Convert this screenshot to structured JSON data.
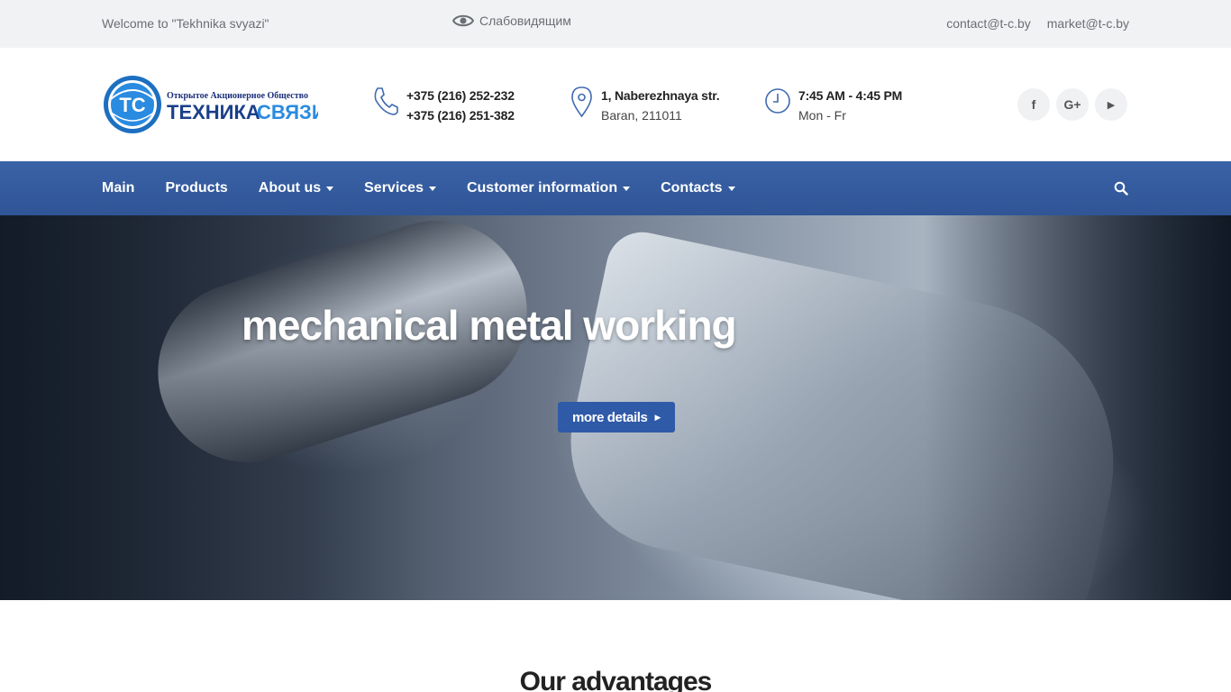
{
  "topbar": {
    "welcome": "Welcome to \"Tekhnika svyazi\"",
    "low_vision": "Слабовидящим",
    "emails": [
      "contact@t-c.by",
      "market@t-c.by"
    ]
  },
  "logo": {
    "mark": "TC",
    "subtitle": "Открытое Акционерное Общество",
    "name_part1": "ТЕХНИКА",
    "name_part2": "СВЯЗИ"
  },
  "contacts": {
    "phones": [
      "+375 (216) 252-232",
      "+375 (216) 251-382"
    ],
    "address_line1": "1, Naberezhnaya str.",
    "address_line2": "Baran, 211011",
    "hours": "7:45 AM - 4:45 PM",
    "days": "Mon - Fr"
  },
  "socials": [
    {
      "name": "facebook-icon",
      "glyph": "f"
    },
    {
      "name": "google-plus-icon",
      "glyph": "G+"
    },
    {
      "name": "youtube-icon",
      "glyph": "▶"
    }
  ],
  "nav": {
    "items": [
      "Main",
      "Products",
      "About us",
      "Services",
      "Customer information",
      "Contacts"
    ]
  },
  "hero": {
    "title": "mechanical metal working",
    "button": "more details"
  },
  "advantages": {
    "title": "Our advantages"
  },
  "colors": {
    "nav_bg": "#2f5597",
    "button_bg": "#2f5aa8",
    "topbar_bg": "#f1f2f4",
    "icon_accent": "#3f6ab0"
  }
}
